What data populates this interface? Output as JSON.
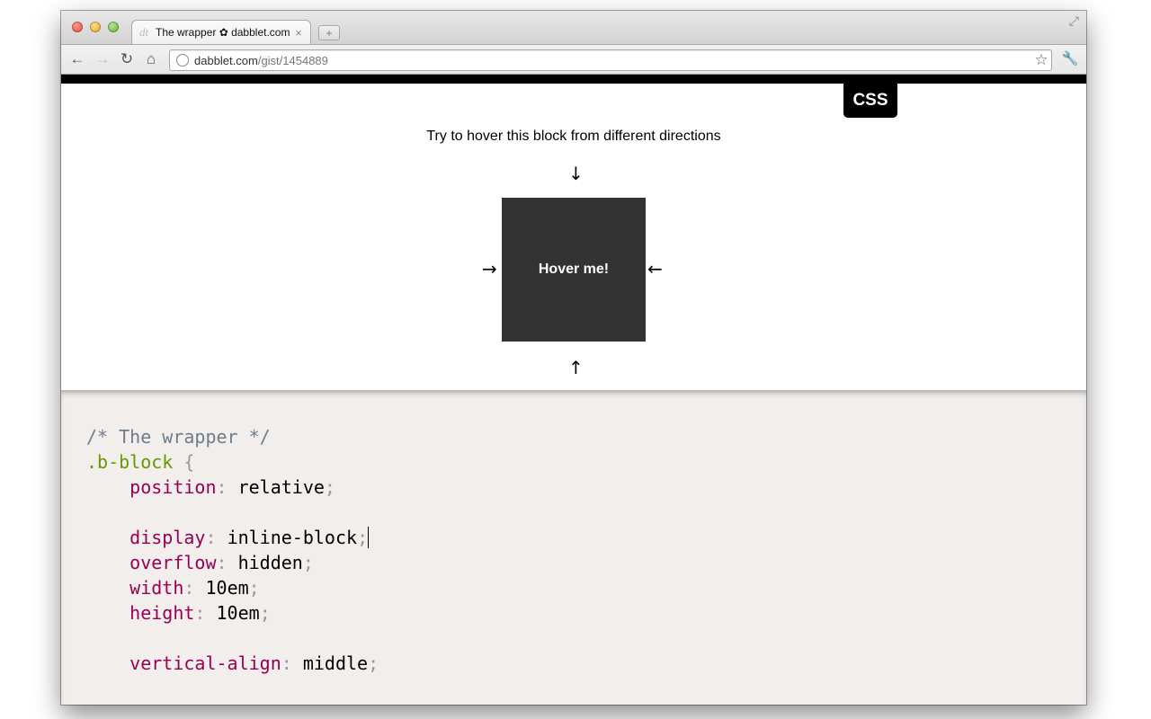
{
  "browser": {
    "tab_title": "The wrapper ✿ dabblet.com",
    "tab_favicon": "dt",
    "tab_close": "×",
    "new_tab": "+",
    "url_host": "dabblet.com",
    "url_path": "/gist/1454889",
    "back_icon": "←",
    "forward_icon": "→",
    "reload_icon": "↻",
    "home_icon": "⌂",
    "star_icon": "☆",
    "wrench_icon": "🔧",
    "fullscreen_icon": "⤢"
  },
  "page": {
    "css_badge": "CSS",
    "hint": "Try to hover this block from different directions",
    "arrow_top": "↓",
    "arrow_left": "→",
    "arrow_right": "←",
    "arrow_bottom": "↑",
    "block_label": "Hover me!"
  },
  "code": {
    "comment": "/* The wrapper */",
    "selector": ".b-block",
    "open_brace": " {",
    "declarations": [
      {
        "prop": "position",
        "value": "relative"
      },
      {
        "prop": "display",
        "value": "inline-block"
      },
      {
        "prop": "overflow",
        "value": "hidden"
      },
      {
        "prop": "width",
        "value": "10em"
      },
      {
        "prop": "height",
        "value": "10em"
      },
      {
        "prop": "vertical-align",
        "value": "middle"
      }
    ],
    "colon": ": ",
    "semicolon": ";",
    "indent": "    "
  },
  "colors": {
    "comment": "#6f7c8a",
    "selector": "#669900",
    "property": "#990055",
    "block": "#333333"
  }
}
